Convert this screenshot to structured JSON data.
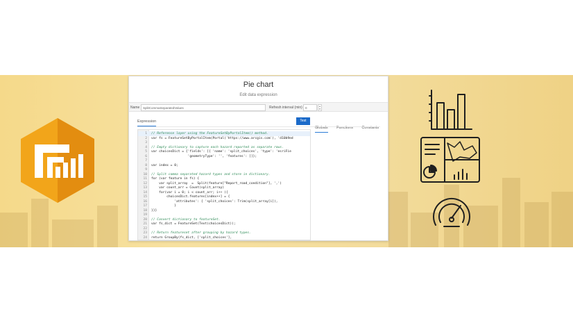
{
  "panel": {
    "title": "Pie chart",
    "subtitle": "Edit data expression",
    "name_label": "Name",
    "name_value": "SplitCommaSeparatedValues",
    "refresh_label": "Refresh interval (min)",
    "refresh_value": "0",
    "test_label": "Test",
    "expression_tab": "Expression",
    "side_tabs": [
      "Globals",
      "Functions",
      "Constants"
    ]
  },
  "code_lines": [
    {
      "n": "1",
      "t": "// Reference layer using the FeatureSetByPortalItem() method.",
      "c": true
    },
    {
      "n": "2",
      "t": "var fs = FeatureSetByPortalItem(Portal('https://www.arcgis.com'), 'd10b9ed",
      "c": false
    },
    {
      "n": "3",
      "t": "",
      "c": false
    },
    {
      "n": "4",
      "t": "// Empty dictionary to capture each hazard reported as separate rows.",
      "c": true
    },
    {
      "n": "5",
      "t": "var choicesDict = {'fields': [{ 'name': 'split_choices', 'type': 'esriFie",
      "c": false
    },
    {
      "n": "6",
      "t": "                   'geometryType': '', 'features': []};",
      "c": false
    },
    {
      "n": "7",
      "t": "",
      "c": false
    },
    {
      "n": "8",
      "t": "var index = 0;",
      "c": false
    },
    {
      "n": "9",
      "t": "",
      "c": false
    },
    {
      "n": "10",
      "t": "// Split comma separated hazard types and store in dictionary.",
      "c": true
    },
    {
      "n": "11",
      "t": "for (var feature in fs) {",
      "c": false
    },
    {
      "n": "12",
      "t": "    var split_array  =  Split(feature[\"Report_road_condition\"], ',')",
      "c": false
    },
    {
      "n": "13",
      "t": "    var count_arr = Count(split_array)",
      "c": false
    },
    {
      "n": "14",
      "t": "    for(var i = 0; i < count_arr; i++ ){",
      "c": false
    },
    {
      "n": "15",
      "t": "        choicesDict.features[index++] = {",
      "c": false
    },
    {
      "n": "16",
      "t": "            'attributes': { 'split_choices': Trim(split_array[i]),",
      "c": false
    },
    {
      "n": "17",
      "t": "            }",
      "c": false
    },
    {
      "n": "18",
      "t": "}}}",
      "c": false
    },
    {
      "n": "19",
      "t": "",
      "c": false
    },
    {
      "n": "20",
      "t": "// Convert dictionary to featureSet.",
      "c": true
    },
    {
      "n": "21",
      "t": "var fs_dict = FeatureSet(Text(choicesDict));",
      "c": false
    },
    {
      "n": "22",
      "t": "",
      "c": false
    },
    {
      "n": "23",
      "t": "// Return featureset after grouping by hazard types.",
      "c": true
    },
    {
      "n": "24",
      "t": "return GroupBy(fs_dict, ['split_choices'],",
      "c": false
    }
  ],
  "colors": {
    "banner": "#f5d98a",
    "logo_orange": "#f2a51a",
    "logo_dark": "#e08a0e",
    "accent_blue": "#1b6ac9"
  },
  "icons": [
    "dashboard-app-logo",
    "bar-chart-icon",
    "dashboard-layout-icon",
    "gauge-icon"
  ]
}
